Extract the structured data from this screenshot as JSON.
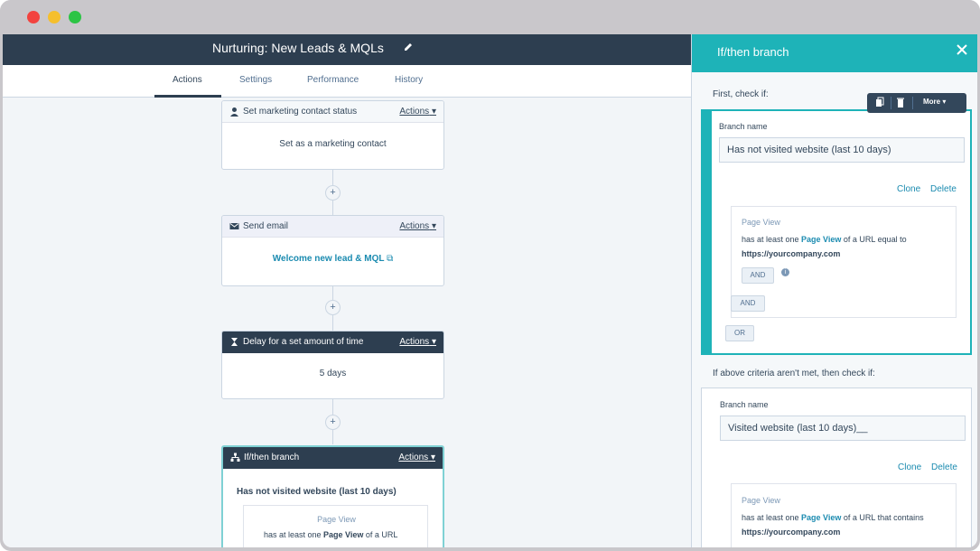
{
  "workflow": {
    "title": "Nurturing: New Leads & MQLs",
    "tabs": [
      "Actions",
      "Settings",
      "Performance",
      "History"
    ],
    "active_tab": "Actions",
    "actions_label": "Actions",
    "cards": [
      {
        "title": "Set marketing contact status",
        "body": "Set as a marketing contact"
      },
      {
        "title": "Send email",
        "body": "Welcome new lead & MQL"
      },
      {
        "title": "Delay for a set amount of time",
        "body": "5 days"
      },
      {
        "title": "If/then branch",
        "body": "Has not visited website (last 10 days)",
        "sub_label": "Page View",
        "sub_text_a": "has at least one ",
        "sub_link": "Page View",
        "sub_text_b": " of a URL"
      }
    ],
    "plus": "+"
  },
  "panel": {
    "title": "If/then branch",
    "first_check": "First, check if:",
    "else_check": "If above criteria aren't met, then check if:",
    "toolbar_more": "More",
    "branches": [
      {
        "name_label": "Branch name",
        "name_value": "Has not visited website (last 10 days)",
        "clone": "Clone",
        "delete": "Delete",
        "filter_type": "Page View",
        "desc_a": "has at least one ",
        "desc_link": "Page View",
        "desc_b": " of a URL equal to",
        "desc_url": "https://yourcompany.com",
        "and_chip": "AND",
        "and_chip_2": "AND",
        "or_chip": "OR"
      },
      {
        "name_label": "Branch name",
        "name_value": "Visited website (last 10 days)__",
        "clone": "Clone",
        "delete": "Delete",
        "filter_type": "Page View",
        "desc_a": "has at least one ",
        "desc_link": "Page View",
        "desc_b": " of a URL that contains",
        "desc_url": "https://yourcompany.com"
      }
    ]
  },
  "colors": {
    "header": "#2d3e50",
    "accent": "#1eb3b8",
    "link": "#1b8bb0"
  }
}
